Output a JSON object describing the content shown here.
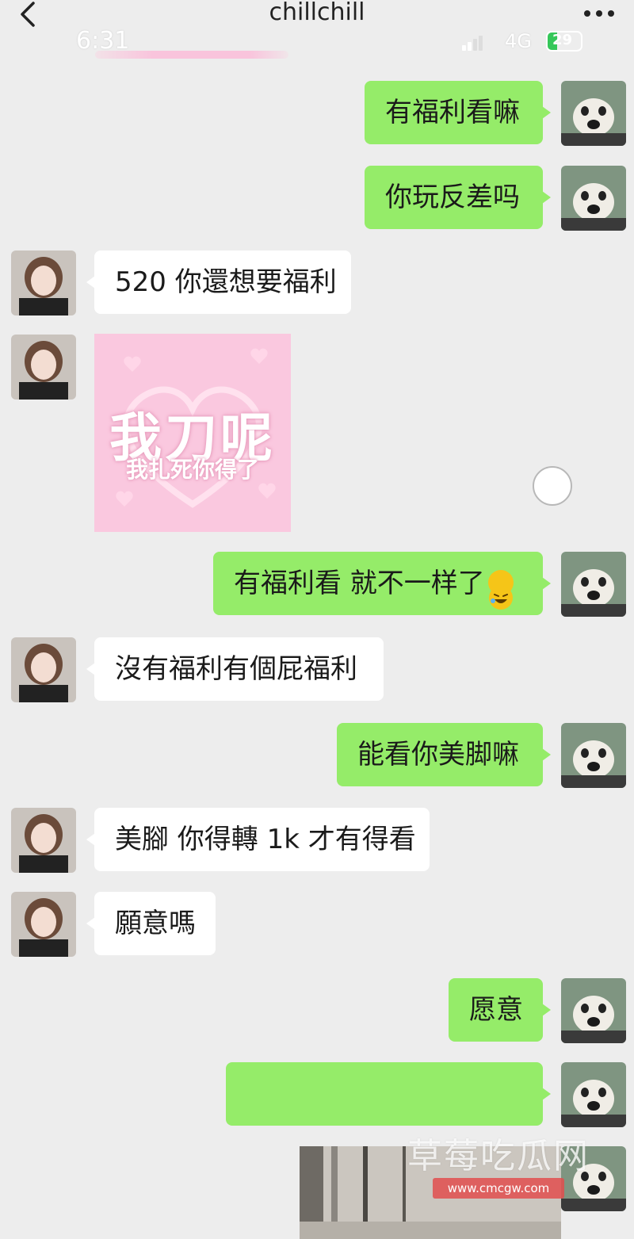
{
  "header": {
    "title": "chillchill",
    "status_time": "6:31",
    "network": "4G",
    "battery": "29",
    "battery_level": 0.29
  },
  "colors": {
    "sent_bubble": "#95ec69",
    "received_bubble": "#ffffff",
    "background": "#ededed"
  },
  "messages": [
    {
      "from": "me",
      "text": "有福利看嘛"
    },
    {
      "from": "me",
      "text": "你玩反差吗"
    },
    {
      "from": "her",
      "text": "520 你還想要福利"
    },
    {
      "from": "her",
      "sticker": {
        "big": "我刀呢",
        "small": "我扎死你得了"
      }
    },
    {
      "from": "me",
      "text": "有福利看 就不一样了",
      "emoji": "rolling-on-floor-laughing"
    },
    {
      "from": "her",
      "text": "沒有福利有個屁福利"
    },
    {
      "from": "me",
      "text": "能看你美脚嘛"
    },
    {
      "from": "her",
      "text": "美腳 你得轉 1k 才有得看"
    },
    {
      "from": "her",
      "text": "願意嗎"
    },
    {
      "from": "me",
      "text": "愿意"
    },
    {
      "from": "me",
      "text": ""
    }
  ],
  "watermark": {
    "text": "草莓吃瓜网",
    "url": "www.cmcgw.com"
  }
}
